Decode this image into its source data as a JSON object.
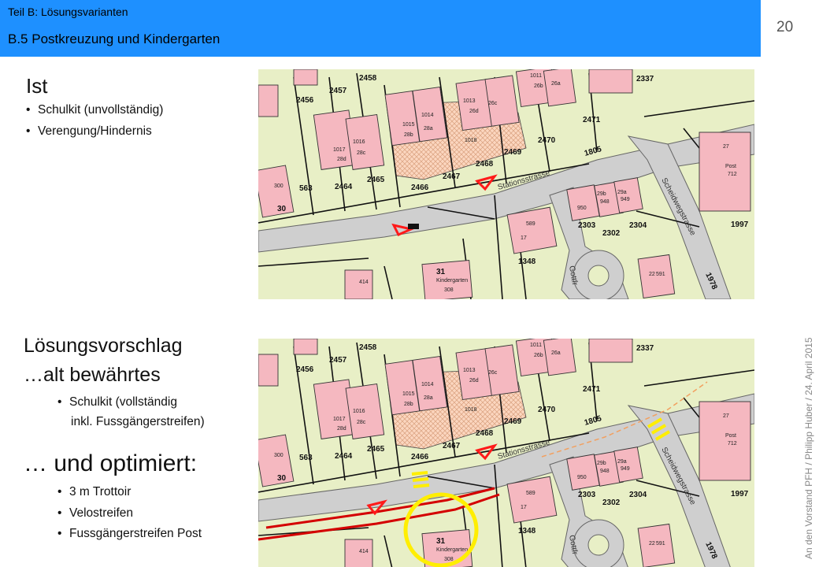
{
  "header": {
    "section_label": "Teil B: Lösungsvarianten",
    "title": "B.5  Postkreuzung und Kindergarten",
    "bg_color": "#1e90ff"
  },
  "page_number": "20",
  "side_note": "An den Vorstand PFH / Philipp Huber / 24. April 2015",
  "ist": {
    "heading": "Ist",
    "bullets": [
      "Schulkit (unvollständig)",
      "Verengung/Hindernis"
    ]
  },
  "proposal": {
    "heading1": "Lösungsvorschlag",
    "heading2": "…alt bewährtes",
    "bullet1_line1": "Schulkit (vollständig",
    "bullet1_line2": "inkl. Fussgängerstreifen)",
    "heading3": "… und optimiert:",
    "bullets": [
      "3 m Trottoir",
      "Velostreifen",
      "Fussgängerstreifen  Post"
    ]
  },
  "map_labels": {
    "parcels": [
      "2458",
      "2457",
      "2456",
      "2337",
      "2471",
      "2470",
      "2469",
      "2468",
      "2467",
      "2466",
      "2465",
      "2464",
      "563",
      "1805",
      "2303",
      "2302",
      "2304",
      "1348",
      "1997",
      "1978",
      "30",
      "31",
      "308",
      "17",
      "27",
      "712",
      "300",
      "414",
      "589",
      "591",
      "22",
      "950",
      "948",
      "949",
      "1011",
      "1012",
      "1013",
      "1014",
      "1015",
      "1016",
      "1017",
      "1018"
    ],
    "houses": [
      "26b",
      "26a",
      "26d",
      "26c",
      "28b",
      "28a",
      "28d",
      "28c",
      "29b",
      "29a"
    ],
    "streets": [
      "Stationsstrasse",
      "Scheidwegstrasse",
      "Gottfr"
    ],
    "buildings": [
      "Kindergarten",
      "Post"
    ]
  },
  "colors": {
    "map_bg": "#e8efc6",
    "building": "#f5b8c0",
    "road": "#cfcfcf",
    "marker": "#ff1a1a",
    "proposal_line": "#d40000",
    "highlight": "#ffee00"
  }
}
